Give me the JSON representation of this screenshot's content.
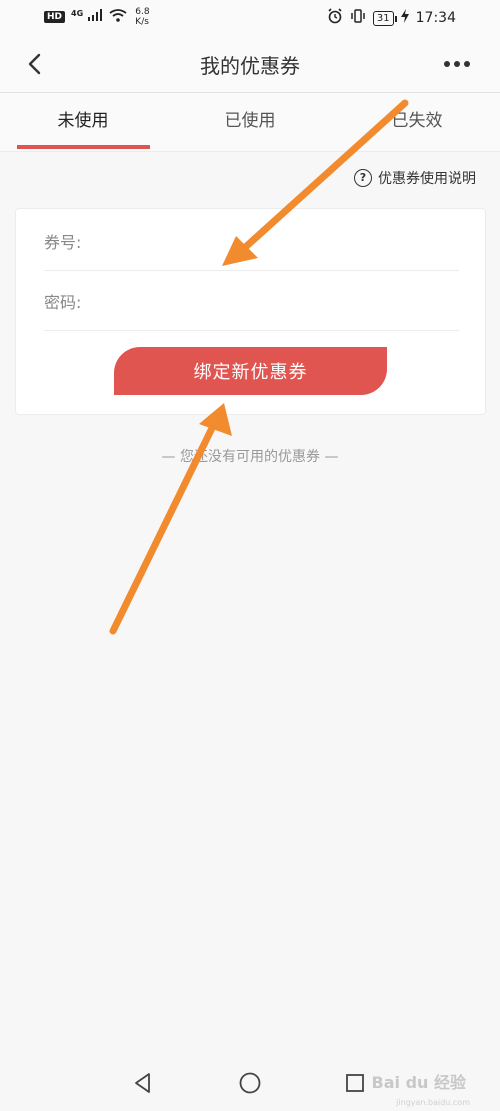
{
  "status_bar": {
    "hd": "HD",
    "network": "4G",
    "speed_value": "6.8",
    "speed_unit": "K/s",
    "battery": "31",
    "time": "17:34"
  },
  "header": {
    "title": "我的优惠券"
  },
  "tabs": [
    {
      "label": "未使用",
      "active": true
    },
    {
      "label": "已使用",
      "active": false
    },
    {
      "label": "已失效",
      "active": false
    }
  ],
  "help_link": {
    "label": "优惠券使用说明"
  },
  "form": {
    "coupon_label": "券号:",
    "coupon_value": "",
    "password_label": "密码:",
    "password_value": "",
    "bind_button": "绑定新优惠券"
  },
  "empty_state": {
    "text": "— 您还没有可用的优惠券 —"
  },
  "watermark": {
    "brand": "Bai du 经验",
    "url": "jingyan.baidu.com"
  },
  "colors": {
    "accent": "#dd5450",
    "arrow": "#f28a2e"
  }
}
